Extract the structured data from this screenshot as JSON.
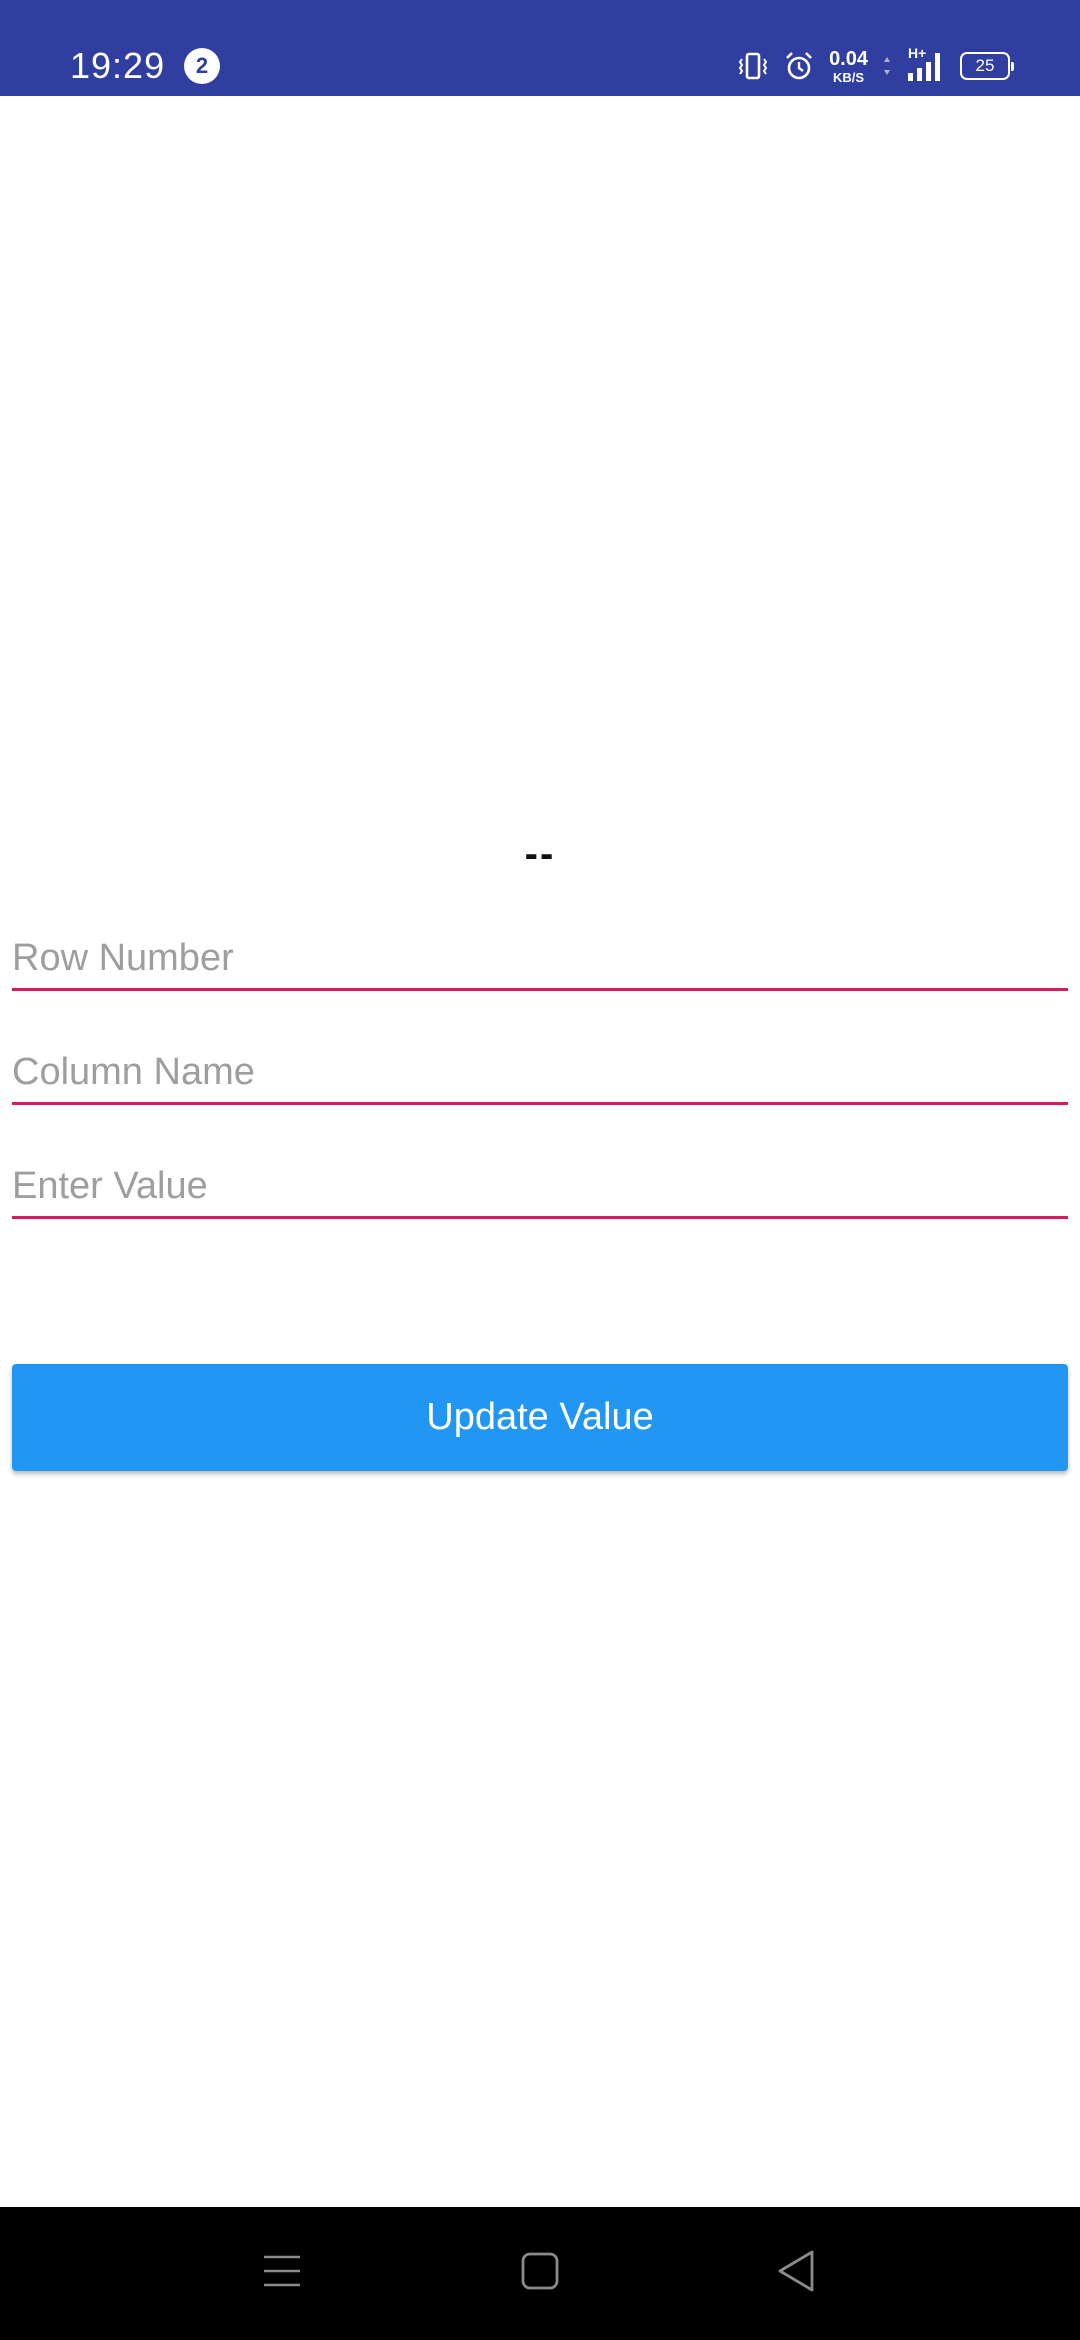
{
  "status_bar": {
    "time": "19:29",
    "notification_count": "2",
    "net_speed_value": "0.04",
    "net_speed_unit": "KB/S",
    "network_type": "H+",
    "battery_level": "25",
    "background_color": "#303F9F",
    "icons": [
      "vibrate-icon",
      "alarm-icon",
      "data-arrows-icon",
      "signal-icon",
      "battery-icon"
    ]
  },
  "main": {
    "result_text": "--",
    "fields": {
      "row_number": {
        "placeholder": "Row Number",
        "value": ""
      },
      "column_name": {
        "placeholder": "Column Name",
        "value": ""
      },
      "enter_value": {
        "placeholder": "Enter Value",
        "value": ""
      }
    },
    "underline_color": "#D81B60",
    "update_button": {
      "label": "Update Value",
      "color": "#2196F3"
    }
  },
  "nav_bar": {
    "icons": [
      "menu-icon",
      "home-icon",
      "back-icon"
    ]
  }
}
